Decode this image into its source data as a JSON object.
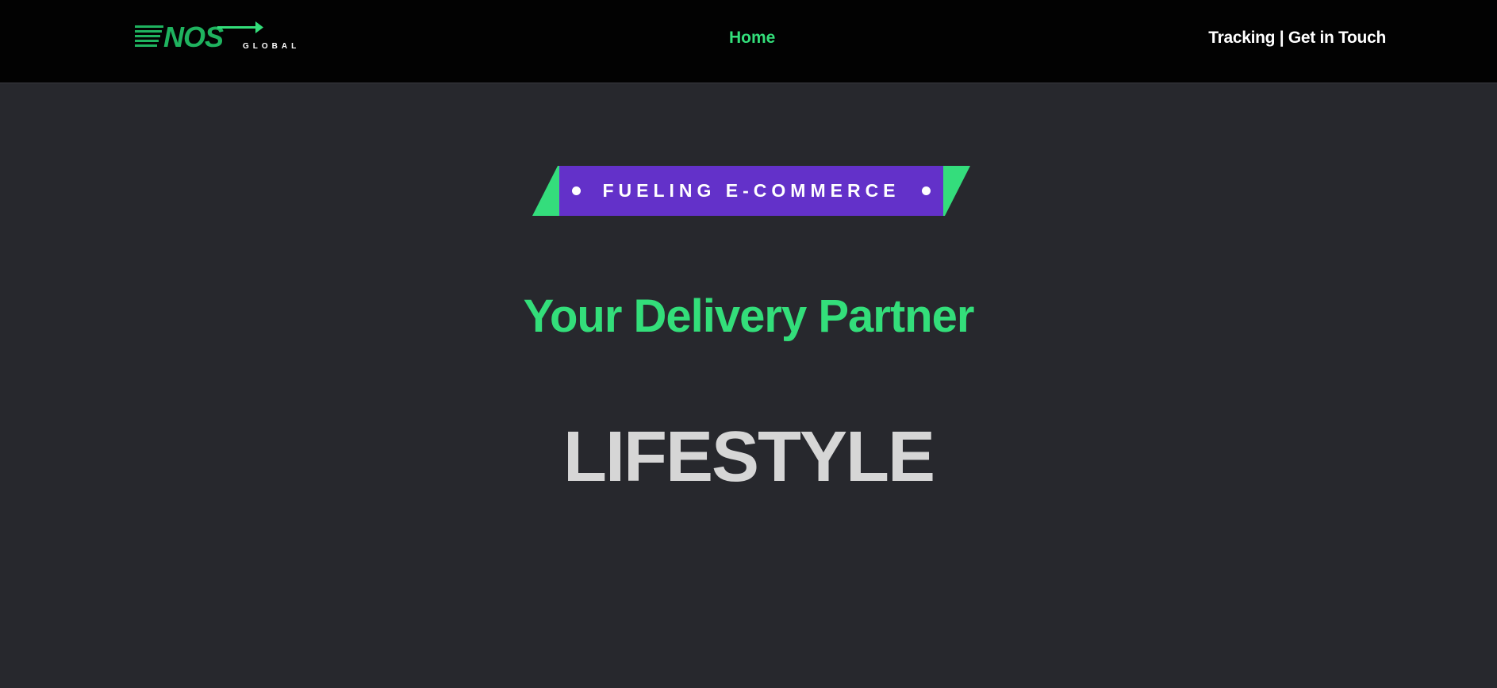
{
  "header": {
    "logo": {
      "brand_text": "NOS",
      "sub_text": "GLOBAL",
      "brand_color": "#1fb35f",
      "accent_color": "#33de7a"
    },
    "nav": {
      "home_label": "Home",
      "right_label": "Tracking | Get in Touch"
    }
  },
  "hero": {
    "badge_label": "FUELING E-COMMERCE",
    "subtitle": "Your Delivery Partner",
    "rotating_word": "LIFESTYLE"
  },
  "colors": {
    "background": "#27282d",
    "header_background": "#020202",
    "accent_green": "#33de7a",
    "badge_purple": "#6331c9",
    "headline_gray": "#d6d6d6"
  }
}
